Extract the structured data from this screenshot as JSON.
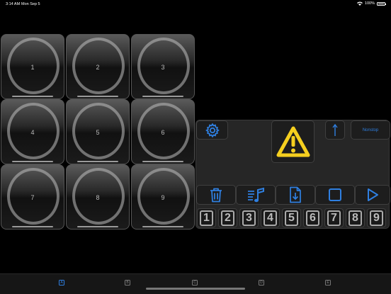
{
  "status": {
    "time": "3:14 AM",
    "date": "Mon Sep 5",
    "battery": "100%"
  },
  "pads": [
    "1",
    "2",
    "3",
    "4",
    "5",
    "6",
    "7",
    "8",
    "9"
  ],
  "panel": {
    "nonstop_label": "Nonstop",
    "icons": [
      "gear-icon",
      "warning-icon",
      "arrow-up-icon",
      "trash-icon",
      "playlist-icon",
      "import-file-icon",
      "stop-icon",
      "play-icon"
    ],
    "accent": "#2f7fe0",
    "warning_color": "#f5cf1f",
    "numbers": [
      "1",
      "2",
      "3",
      "4",
      "5",
      "6",
      "7",
      "8",
      "9"
    ]
  },
  "tabs": [
    "A",
    "B",
    "C",
    "D",
    "E"
  ]
}
